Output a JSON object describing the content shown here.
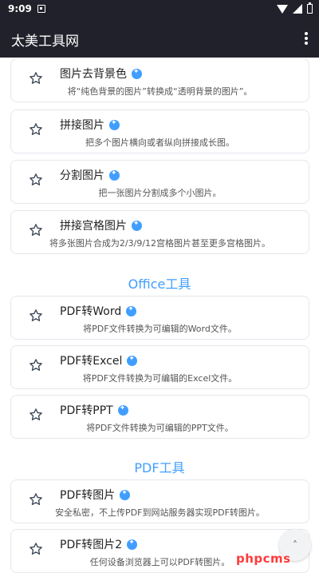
{
  "status_bar": {
    "time": "9:09",
    "icons": [
      "notification-icon",
      "wifi-icon",
      "signal-icon",
      "battery-icon"
    ]
  },
  "app_bar": {
    "title": "太美工具网",
    "menu_icon": "more-vert-icon"
  },
  "image_tools": [
    {
      "title": "图片去背景色",
      "desc": "将“纯色背景的图片”转换成“透明背景的图片”。"
    },
    {
      "title": "拼接图片",
      "desc": "把多个图片横向或者纵向拼接成长图。"
    },
    {
      "title": "分割图片",
      "desc": "把一张图片分割成多个小图片。"
    },
    {
      "title": "拼接宫格图片",
      "desc": "将多张图片合成为2/3/9/12宫格图片甚至更多宫格图片。"
    }
  ],
  "sections": {
    "office": "Office工具",
    "pdf": "PDF工具"
  },
  "office_tools": [
    {
      "title": "PDF转Word",
      "desc": "将PDF文件转换为可编辑的Word文件。"
    },
    {
      "title": "PDF转Excel",
      "desc": "将PDF文件转换为可编辑的Excel文件。"
    },
    {
      "title": "PDF转PPT",
      "desc": "将PDF文件转换为可编辑的PPT文件。"
    }
  ],
  "pdf_tools": [
    {
      "title": "PDF转图片",
      "desc": "安全私密，不上传PDF到网站服务器实现PDF转图片。"
    },
    {
      "title": "PDF转图片2",
      "desc": "任何设备浏览器上可以PDF转图片。"
    }
  ],
  "fab": {
    "icon": "chevron-up-icon",
    "label": "˄"
  },
  "watermark": "phpcms",
  "colors": {
    "header_bg": "#21212b",
    "accent": "#409eff",
    "card_border": "#e4e7ed"
  }
}
